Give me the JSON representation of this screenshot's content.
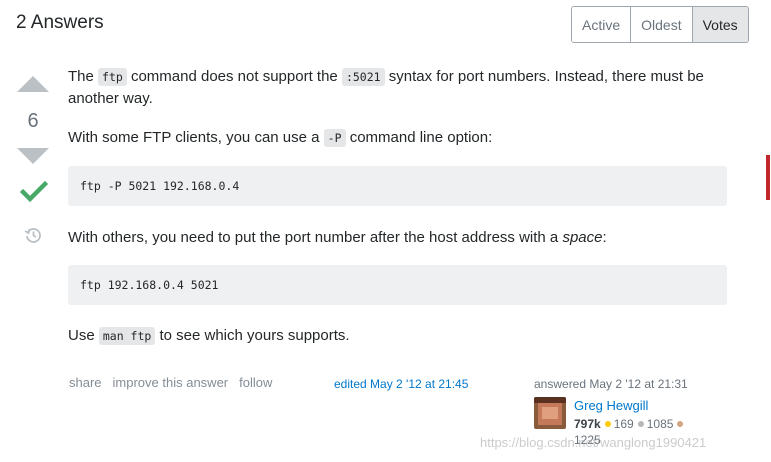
{
  "header": {
    "title": "2 Answers"
  },
  "sort_tabs": [
    {
      "label": "Active"
    },
    {
      "label": "Oldest"
    },
    {
      "label": "Votes"
    }
  ],
  "vote": {
    "count": "6"
  },
  "post": {
    "p1": {
      "a": "The ",
      "code1": "ftp",
      "b": " command does not support the ",
      "code2": ":5021",
      "c": " syntax for port numbers. Instead, there must be another way."
    },
    "p2": {
      "a": "With some FTP clients, you can use a ",
      "code": "-P",
      "b": " command line option:"
    },
    "code_block_1": "ftp -P 5021 192.168.0.4",
    "p3": {
      "a": "With others, you need to put the port number after the host address with a ",
      "em": "space",
      "b": ":"
    },
    "code_block_2": "ftp 192.168.0.4 5021",
    "p4": {
      "a": "Use ",
      "code": "man ftp",
      "b": " to see which yours supports."
    }
  },
  "menu": {
    "share": "share",
    "improve": "improve this answer",
    "follow": "follow"
  },
  "edited": "edited May 2 '12 at 21:45",
  "answered": "answered May 2 '12 at 21:31",
  "user": {
    "name": "Greg Hewgill",
    "reputation": "797k",
    "gold": "169",
    "silver": "1085",
    "bronze": "1225"
  },
  "watermark": "https://blog.csdn.net/wanglong1990421",
  "colors": {
    "link": "#0077cc",
    "accepted": "#48a868",
    "gold": "#ffcc01",
    "silver": "#b4b8bc",
    "bronze": "#d1a684"
  }
}
